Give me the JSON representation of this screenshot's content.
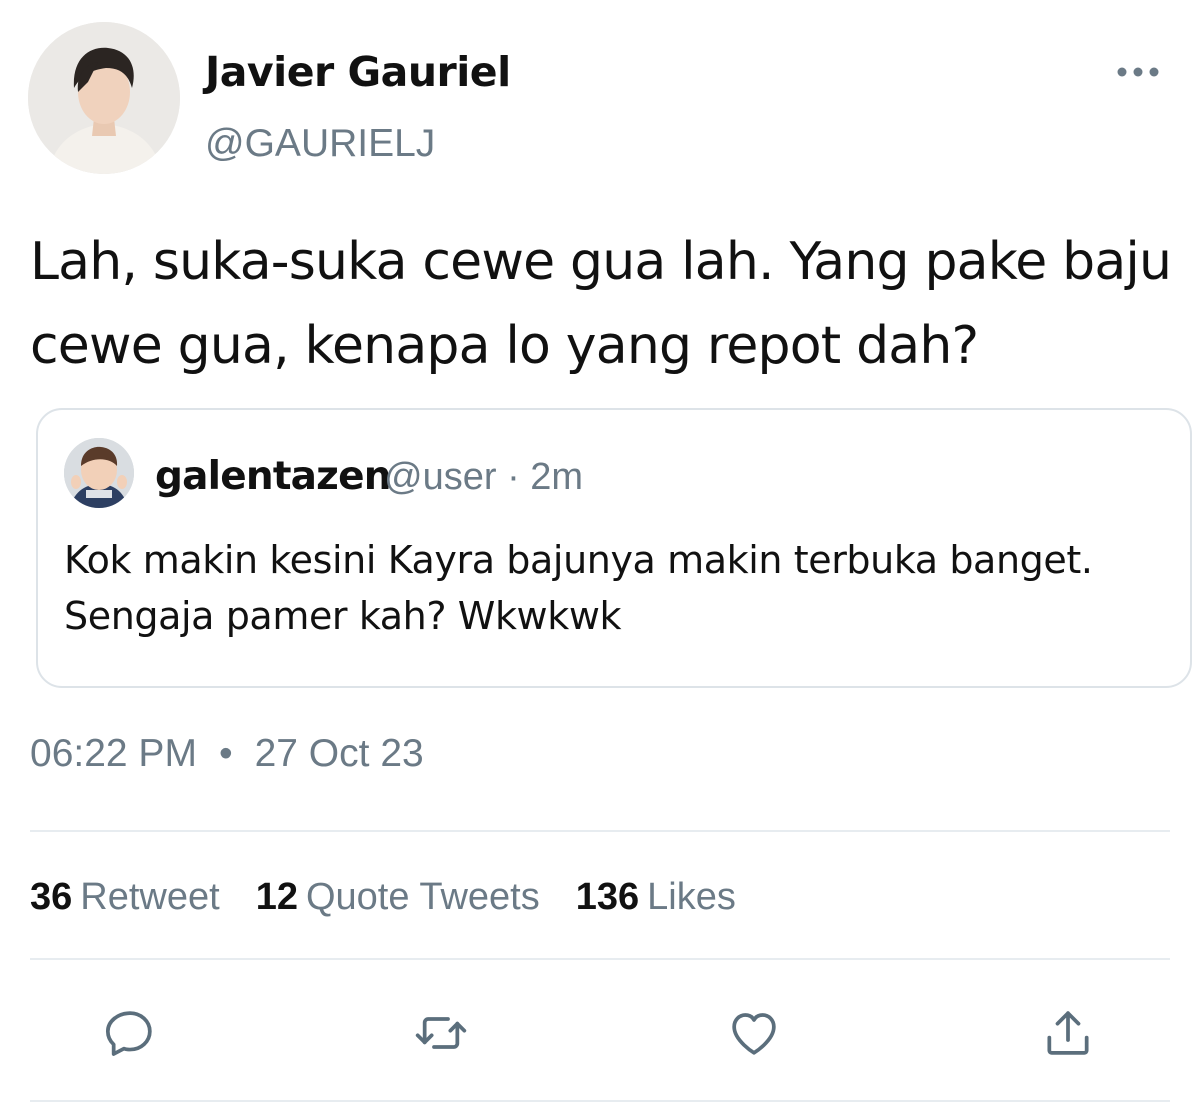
{
  "tweet": {
    "author": {
      "display_name": "Javier Gauriel",
      "handle": "@GAURIELJ"
    },
    "text": "Lah, suka-suka cewe gua lah. Yang pake baju cewe gua, kenapa lo yang repot dah?",
    "quoted": {
      "display_name": "galentazen",
      "handle": "@user",
      "separator": "·",
      "time": "2m",
      "text": "Kok makin kesini Kayra bajunya makin terbuka banget. Sengaja pamer kah? Wkwkwk"
    },
    "time": "06:22 PM",
    "dot": "•",
    "date": "27 Oct 23",
    "stats": {
      "retweets": {
        "count": "36",
        "label": "Retweet"
      },
      "quotes": {
        "count": "12",
        "label": "Quote Tweets"
      },
      "likes": {
        "count": "136",
        "label": "Likes"
      }
    }
  },
  "icons": {
    "more": "more-horizontal-icon",
    "reply": "reply-icon",
    "retweet": "retweet-icon",
    "like": "heart-icon",
    "share": "share-icon"
  },
  "colors": {
    "text": "#111111",
    "secondary": "#6b7a86",
    "border": "#dde3e8",
    "icon": "#5b6e7c"
  }
}
